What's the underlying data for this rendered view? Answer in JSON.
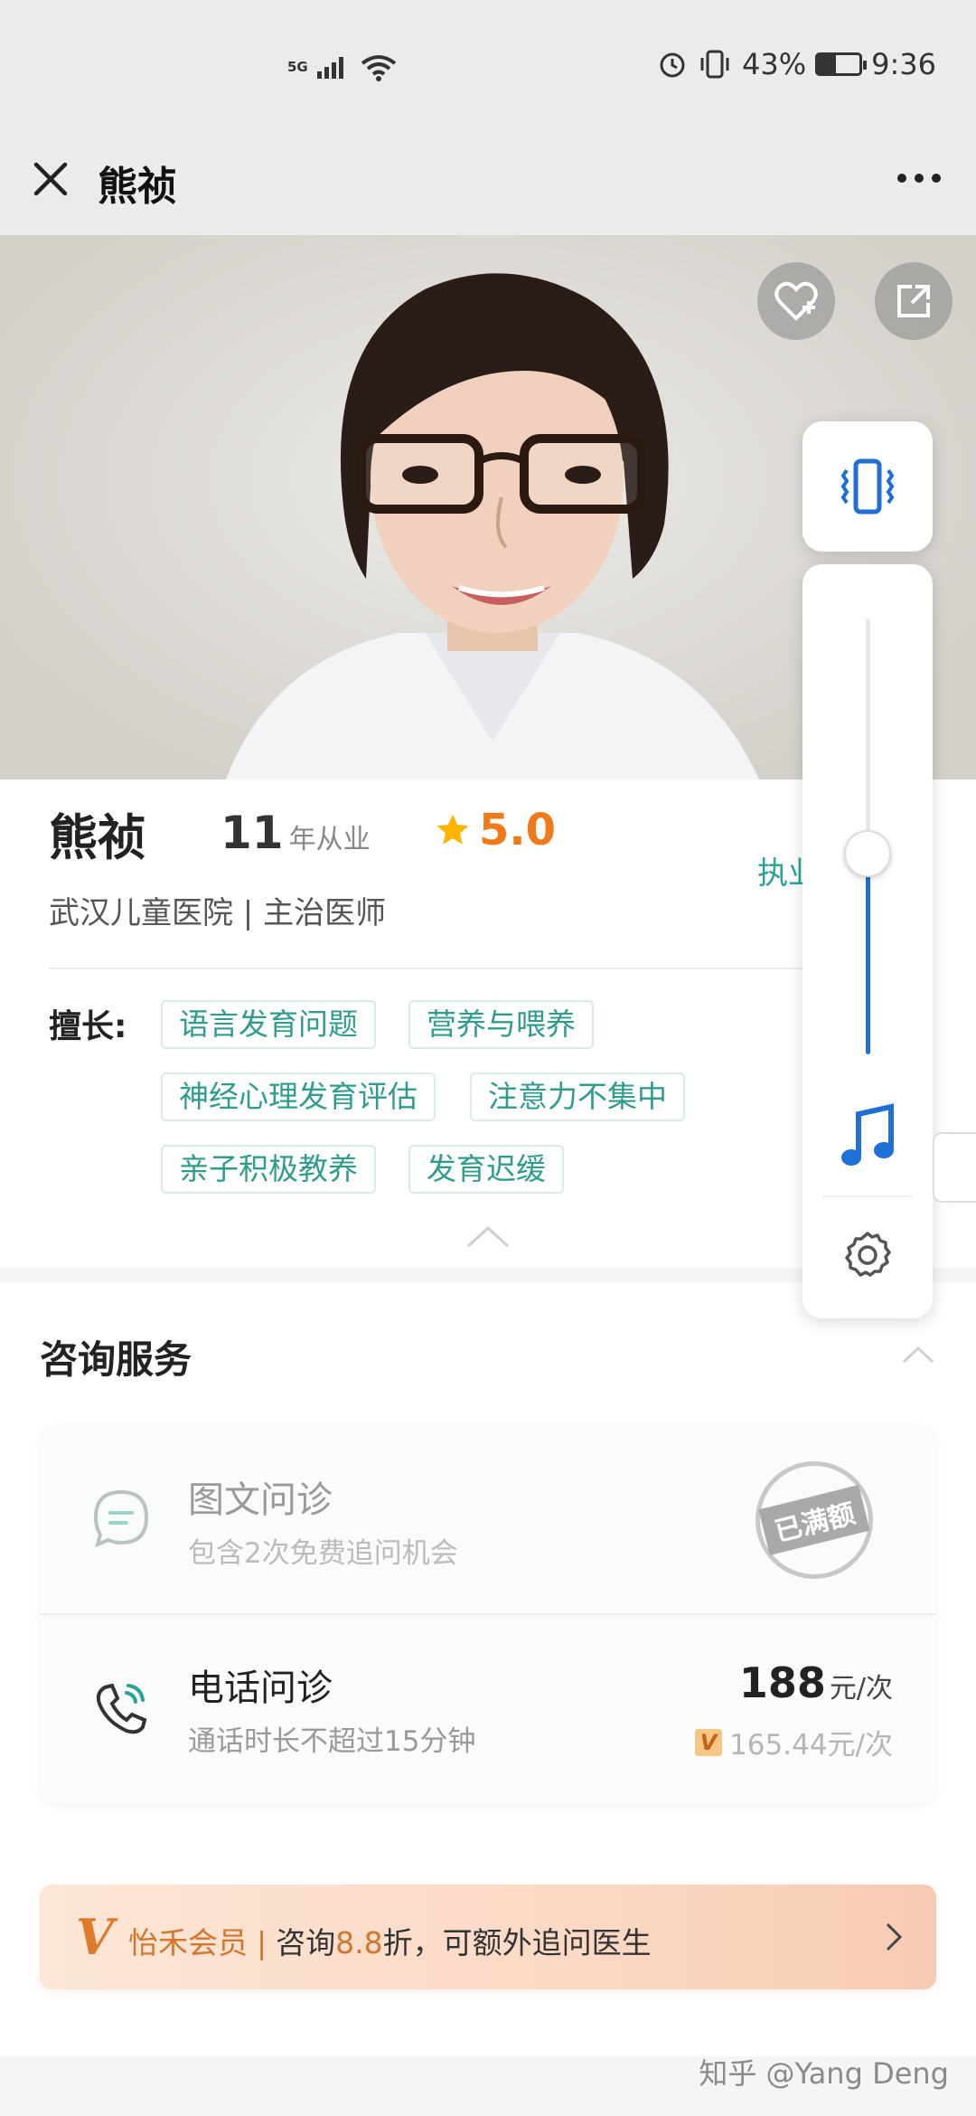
{
  "status_bar": {
    "network": "5G",
    "battery": "43%",
    "battery_level": 0.43,
    "time": "9:36",
    "icons": [
      "signal-icon",
      "wifi-icon",
      "alarm-icon",
      "vibrate-icon",
      "battery-icon"
    ]
  },
  "header": {
    "title": "熊祯",
    "close_icon": "close-icon",
    "more_icon": "more-dots-icon"
  },
  "hero": {
    "favorite_icon": "heart-plus-icon",
    "share_icon": "share-icon"
  },
  "doctor": {
    "name": "熊祯",
    "years": "11",
    "years_unit": "年从业",
    "rating": "5.0",
    "hospital": "武汉儿童医院 | 主治医师",
    "license_partial": "执业",
    "skills_label": "擅长:",
    "skills": [
      "语言发育问题",
      "营养与喂养",
      "神经心理发育评估",
      "注意力不集中",
      "亲子积极教养",
      "发育迟缓"
    ]
  },
  "services": {
    "title": "咨询服务",
    "items": [
      {
        "name": "图文问诊",
        "desc": "包含2次免费追问机会",
        "status": "已满额",
        "icon": "chat-bubble-icon"
      },
      {
        "name": "电话问诊",
        "desc": "通话时长不超过15分钟",
        "price": "188",
        "price_unit": "元/次",
        "vip_badge": "V",
        "vip_price": "165.44元/次",
        "icon": "phone-icon"
      }
    ]
  },
  "vip": {
    "logo": "V",
    "brand": "怡禾会员",
    "separator": "|",
    "text_before": "咨询",
    "discount": "8.8",
    "text_after": "折，可额外追问医生"
  },
  "volume_overlay": {
    "vibrate_icon": "vibrate-mode-icon",
    "level": 0.46,
    "music_icon": "music-note-icon",
    "settings_icon": "gear-icon"
  },
  "watermark": "知乎 @Yang Deng",
  "colors": {
    "teal": "#2f9c8e",
    "orange": "#f07a1a",
    "blue": "#1f6fd6",
    "vip_gold": "#d1772e"
  }
}
